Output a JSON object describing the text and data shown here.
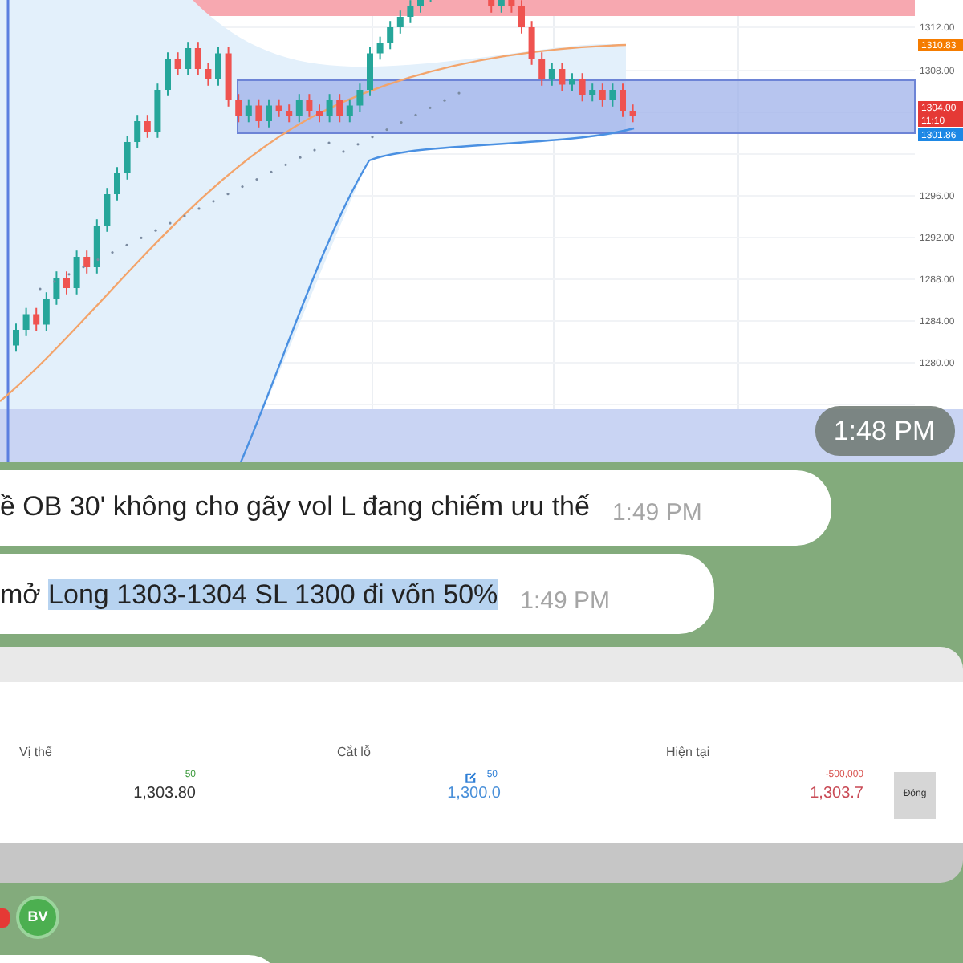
{
  "chart": {
    "price_labels": [
      "1312.00",
      "1308.00",
      "1296.00",
      "1292.00",
      "1288.00",
      "1284.00",
      "1280.00"
    ],
    "price_tags": [
      {
        "text": "1310.83",
        "color": "#f57c00"
      },
      {
        "text": "1304.00",
        "color": "#e53935"
      },
      {
        "text": "11:10",
        "color": "#e53935"
      },
      {
        "text": "1301.86",
        "color": "#1e88e5"
      }
    ],
    "time": "1:48 PM"
  },
  "messages": [
    {
      "text": "ề OB 30' không cho gãy vol L đang chiếm ưu thế",
      "time": "1:49 PM"
    },
    {
      "text": "mở",
      "selected_text": "Long 1303-1304 SL 1300 đi vốn 50%",
      "time": "1:49 PM"
    }
  ],
  "positions_table": {
    "columns": [
      "Vị thế",
      "Cắt lỗ",
      "Hiện tại"
    ],
    "rows": [
      {
        "size": "50",
        "entry": "1,303.80",
        "stop_size": "50",
        "stop_price": "1,300.0",
        "pnl": "-500,000",
        "current": "1,303.7",
        "button": "Đóng"
      }
    ]
  },
  "avatar": {
    "initials": "BV"
  }
}
